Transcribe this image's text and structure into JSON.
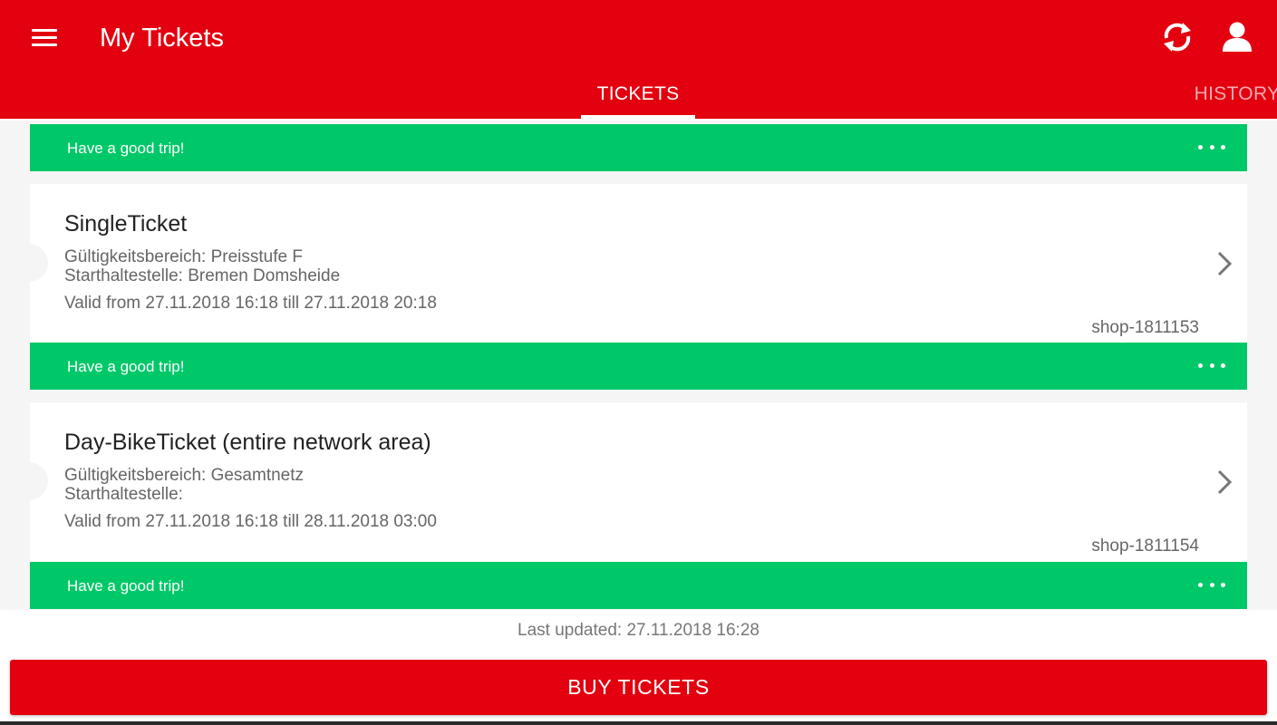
{
  "app_bar": {
    "title": "My Tickets",
    "menu_icon": "hamburger-menu-icon",
    "refresh_icon": "refresh-icon",
    "account_icon": "account-icon",
    "background_color": "#e3000f"
  },
  "tabs": [
    {
      "label": "TICKETS",
      "selected": true
    },
    {
      "label": "HISTORY",
      "selected": false
    }
  ],
  "status_bars": [
    {
      "text": "Have a good trip!",
      "color": "#00c868",
      "more_icon": "more-horizontal-icon"
    },
    {
      "text": "Have a good trip!",
      "color": "#00c868",
      "more_icon": "more-horizontal-icon"
    },
    {
      "text": "Have a good trip!",
      "color": "#00c868",
      "more_icon": "more-horizontal-icon"
    }
  ],
  "tickets": [
    {
      "name": "SingleTicket",
      "zone": "Gültigkeitsbereich: Preisstufe F",
      "start_stop": "Starthaltestelle: Bremen Domsheide",
      "validity": "Valid from 27.11.2018 16:18 till 27.11.2018 20:18",
      "id": "shop-1811153"
    },
    {
      "name": "Day-BikeTicket (entire network area)",
      "zone": "Gültigkeitsbereich: Gesamtnetz",
      "start_stop": "Starthaltestelle:",
      "validity": "Valid from 27.11.2018 16:18 till 28.11.2018 03:00",
      "id": "shop-1811154"
    }
  ],
  "footer": {
    "last_updated": "Last updated: 27.11.2018 16:28",
    "buy_label": "BUY TICKETS"
  }
}
